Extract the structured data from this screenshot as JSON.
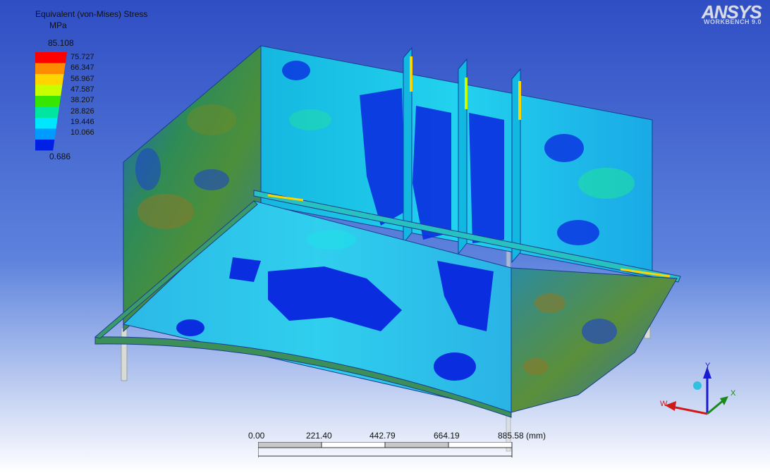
{
  "legend": {
    "title": "Equivalent (von-Mises) Stress",
    "unit": "MPa",
    "max": "85.108",
    "values": [
      "75.727",
      "66.347",
      "56.967",
      "47.587",
      "38.207",
      "28.826",
      "19.446",
      "10.066"
    ],
    "min": "0.686",
    "colors": [
      "#ff0000",
      "#ff8c00",
      "#ffd400",
      "#c8ff00",
      "#37e600",
      "#00e6a0",
      "#00e6ff",
      "#009bff",
      "#0020e6"
    ]
  },
  "brand": {
    "name": "ANSYS",
    "sub": "WORKBENCH 9.0"
  },
  "scale": {
    "ticks": [
      "0.00",
      "221.40",
      "442.79",
      "664.19",
      "885.58 (mm)"
    ]
  },
  "triad": {
    "y": "Y",
    "x": "X",
    "w": "W"
  },
  "colors": {
    "bg_top": "#2f4ec4",
    "bg_bottom": "#ffffff"
  }
}
